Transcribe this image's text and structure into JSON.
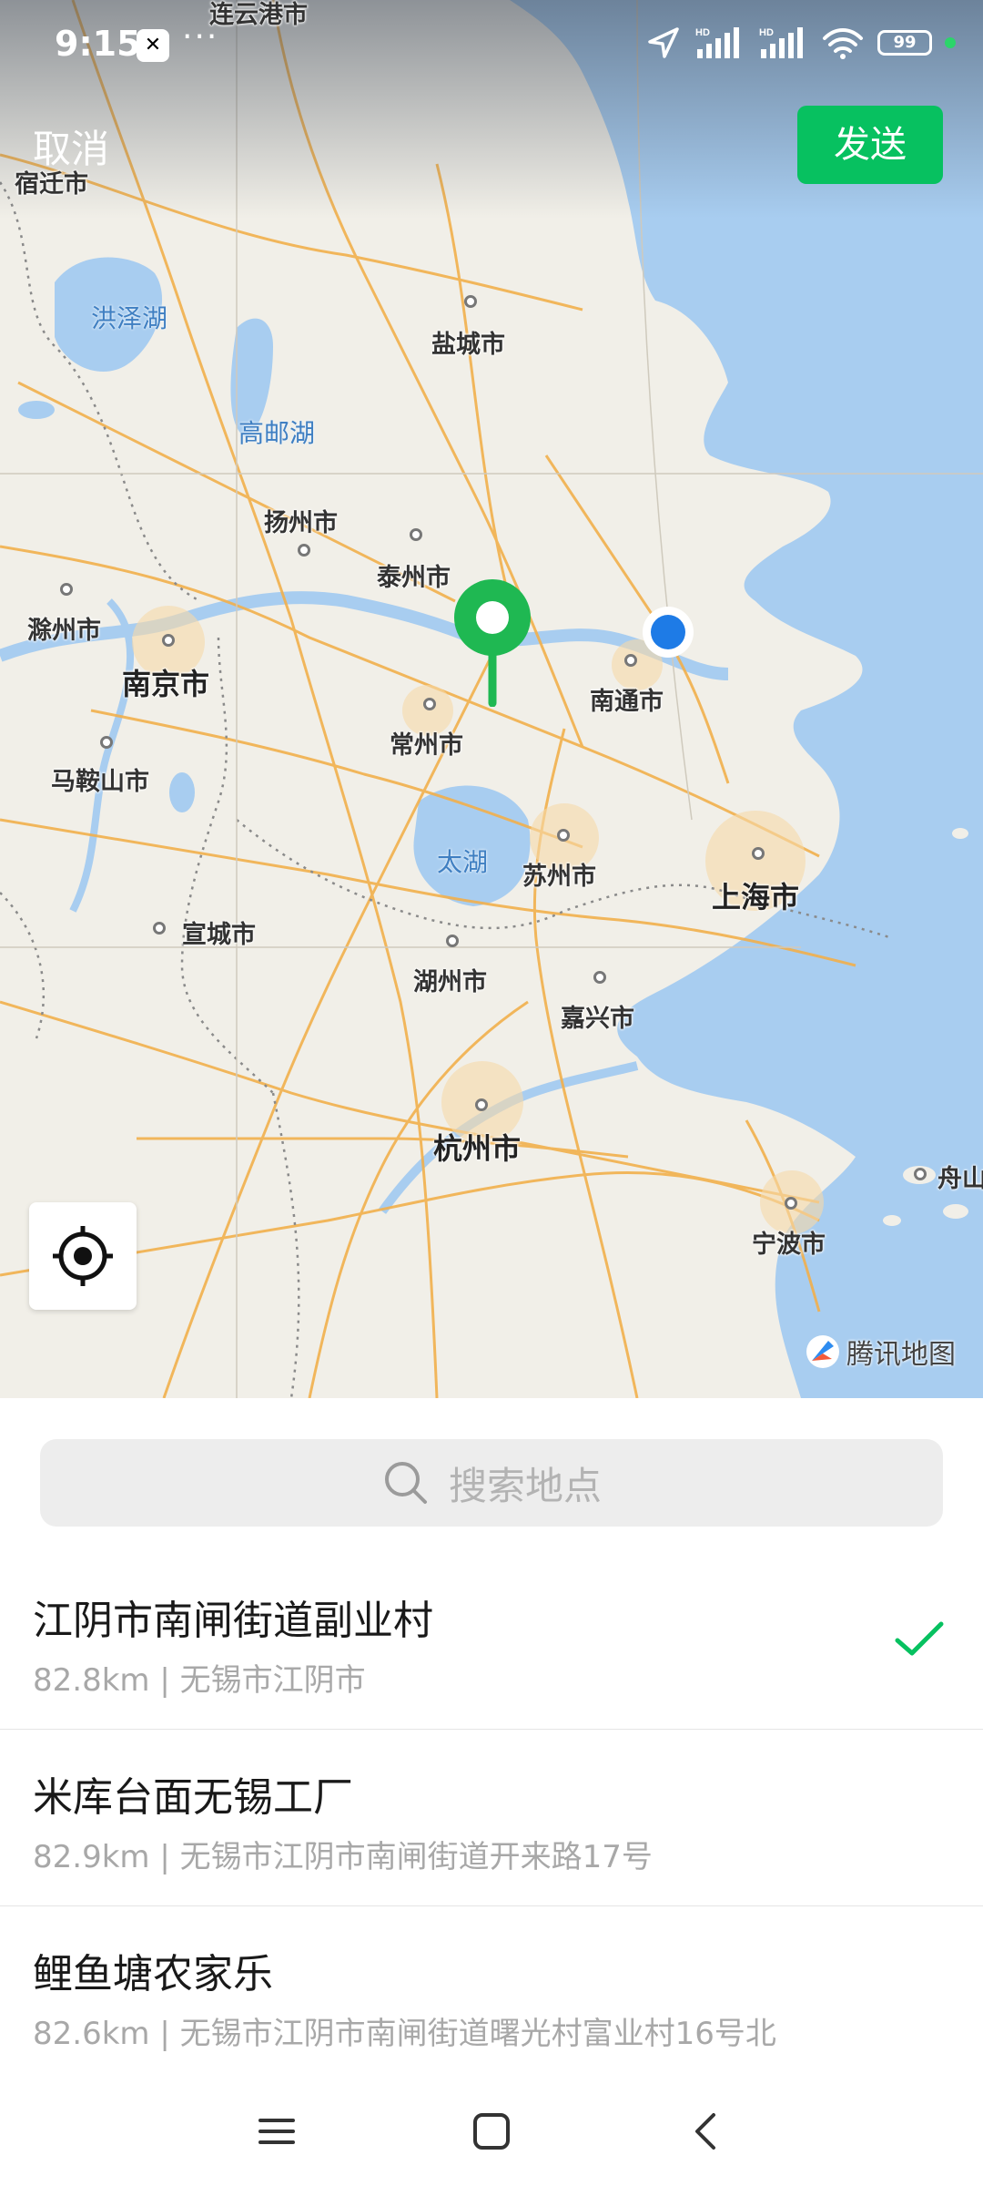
{
  "status_bar": {
    "time": "9:15",
    "app_badge": "CapCut",
    "more": "···",
    "battery": "99",
    "signal_label_1": "HD",
    "signal_label_2": "HD"
  },
  "header": {
    "cancel_label": "取消",
    "send_label": "发送"
  },
  "map": {
    "cities": [
      "连云港市",
      "宿迁市",
      "盐城市",
      "扬州市",
      "泰州市",
      "滁州市",
      "南京市",
      "南通市",
      "常州市",
      "马鞍山市",
      "苏州市",
      "上海市",
      "宣城市",
      "湖州市",
      "嘉兴市",
      "杭州市",
      "宁波市",
      "舟山"
    ],
    "lakes": [
      "洪泽湖",
      "高邮湖",
      "太湖"
    ],
    "watermark": "腾讯地图",
    "colors": {
      "selected_pin": "#1fb852",
      "current_location": "#1e7be6",
      "water": "#a8cdf0",
      "road": "#f2b04c"
    }
  },
  "search": {
    "placeholder": "搜索地点"
  },
  "results": [
    {
      "name": "江阴市南闸街道副业村",
      "detail": "82.8km | 无锡市江阴市",
      "selected": true
    },
    {
      "name": "米库台面无锡工厂",
      "detail": "82.9km | 无锡市江阴市南闸街道开来路17号",
      "selected": false
    },
    {
      "name": "鲤鱼塘农家乐",
      "detail": "82.6km | 无锡市江阴市南闸街道曙光村富业村16号北",
      "selected": false
    }
  ],
  "accent_color": "#07c160"
}
